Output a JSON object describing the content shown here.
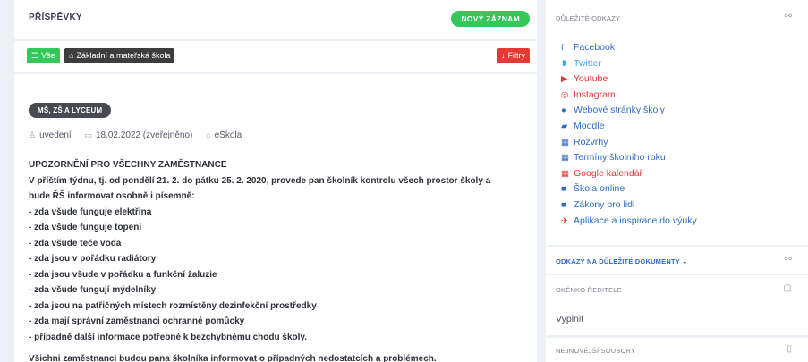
{
  "posts_header": {
    "title": "PŘÍSPĚVKY",
    "new_label": "NOVÝ ZÁZNAM"
  },
  "filters": {
    "all_label": "Vše",
    "school_label": "Základní a mateřská škola",
    "filter_label": "Filtry"
  },
  "post": {
    "badge": "MŠ, ZŠ A LYCEUM",
    "author": "uvedení",
    "date": "18.02.2022 (zveřejněno)",
    "source": "eŠkola",
    "lines": [
      "UPOZORNĚNÍ PRO VŠECHNY ZAMĚSTNANCE",
      "V příštím týdnu, tj. od pondělí 21. 2. do pátku 25. 2. 2020, provede pan školník kontrolu všech prostor školy a",
      "bude ŘŠ informovat osobně i písemně:",
      "- zda všude funguje elektřina",
      "- zda všude funguje topení",
      "- zda všude teče voda",
      "- zda jsou v pořádku radiátory",
      "- zda jsou všude v pořádku a funkční žaluzie",
      "- zda všude fungují mýdelníky",
      "- zda jsou na patřičných místech rozmístěny dezinfekční prostředky",
      "- zda mají správní zaměstnanci ochranné pomůcky",
      "- případně další informace potřebné k bezchybnému chodu školy."
    ],
    "last_line": "Všichni zaměstnanci budou pana školníka informovat o případných nedostatcích a problémech."
  },
  "important_links": {
    "title": "DŮLEŽITÉ ODKAZY",
    "items": [
      {
        "label": "Facebook",
        "icon": "facebook-icon",
        "glyph": "f",
        "color": "#2f6ac2"
      },
      {
        "label": "Twitter",
        "icon": "twitter-icon",
        "glyph": "🐦",
        "color": "#42a5f5"
      },
      {
        "label": "Youtube",
        "icon": "youtube-icon",
        "glyph": "▶",
        "color": "#e53935"
      },
      {
        "label": "Instagram",
        "icon": "instagram-icon",
        "glyph": "◎",
        "color": "#e53935"
      },
      {
        "label": "Webové stránky školy",
        "icon": "globe-icon",
        "glyph": "●",
        "color": "#2f6ac2"
      },
      {
        "label": "Moodle",
        "icon": "book-icon",
        "glyph": "▰",
        "color": "#2f6ac2"
      },
      {
        "label": "Rozvrhy",
        "icon": "calendar-icon",
        "glyph": "▦",
        "color": "#2f6ac2"
      },
      {
        "label": "Termíny školního roku",
        "icon": "calendar-icon",
        "glyph": "▦",
        "color": "#2f6ac2"
      },
      {
        "label": "Google kalendář",
        "icon": "calendar-icon",
        "glyph": "▦",
        "color": "#e53935"
      },
      {
        "label": "Škola online",
        "icon": "square-icon",
        "glyph": "■",
        "color": "#2f6ac2"
      },
      {
        "label": "Zákony pro lidi",
        "icon": "square-icon",
        "glyph": "■",
        "color": "#2f6ac2"
      },
      {
        "label": "Aplikace a inspirace do výuky",
        "icon": "plane-icon",
        "glyph": "✈",
        "color": "#e53935"
      }
    ]
  },
  "documents": {
    "title": "ODKAZY NA DŮLEŽITÉ DOKUMENTY ⌄"
  },
  "director": {
    "title": "OKÉNKO ŘEDITELE",
    "body": "Vyplnit"
  },
  "files": {
    "title": "NEJNOVĚJŠÍ SOUBORY"
  }
}
